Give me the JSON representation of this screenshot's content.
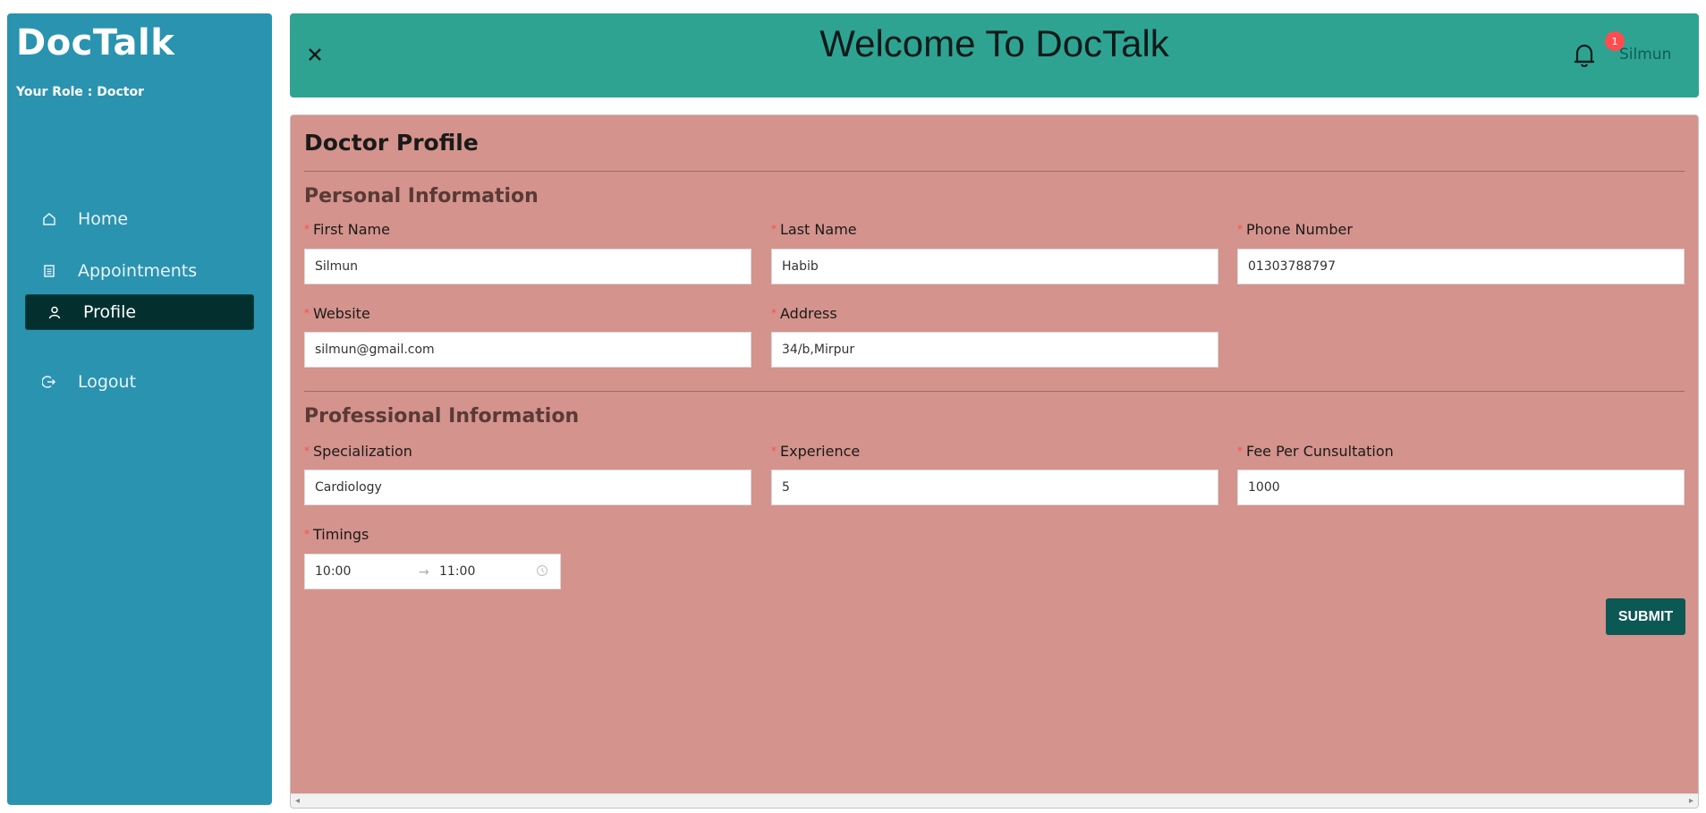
{
  "sidebar": {
    "brand": "DocTalk",
    "role": "Your Role : Doctor",
    "items": [
      {
        "label": "Home",
        "icon": "home-icon"
      },
      {
        "label": "Appointments",
        "icon": "list-icon"
      },
      {
        "label": "Profile",
        "icon": "user-icon",
        "active": true
      },
      {
        "label": "Logout",
        "icon": "logout-icon"
      }
    ]
  },
  "header": {
    "title": "Welcome To DocTalk",
    "notification_count": "1",
    "username": "Silmun"
  },
  "form": {
    "title": "Doctor Profile",
    "personal_section": "Personal Information",
    "professional_section": "Professional Information",
    "fields": {
      "first_name": {
        "label": "First Name",
        "value": "Silmun"
      },
      "last_name": {
        "label": "Last Name",
        "value": "Habib"
      },
      "phone": {
        "label": "Phone Number",
        "value": "01303788797"
      },
      "website": {
        "label": "Website",
        "value": "silmun@gmail.com"
      },
      "address": {
        "label": "Address",
        "value": "34/b,Mirpur"
      },
      "specialization": {
        "label": "Specialization",
        "value": "Cardiology"
      },
      "experience": {
        "label": "Experience",
        "value": "5"
      },
      "fee": {
        "label": "Fee Per Cunsultation",
        "value": "1000"
      },
      "timings": {
        "label": "Timings",
        "start": "10:00",
        "end": "11:00"
      }
    },
    "submit_label": "SUBMIT"
  },
  "colors": {
    "sidebar_bg": "#2a93b0",
    "header_bg": "#2fa391",
    "content_bg": "#d4938c",
    "active_nav": "#03302f",
    "submit_bg": "#0b5854"
  }
}
